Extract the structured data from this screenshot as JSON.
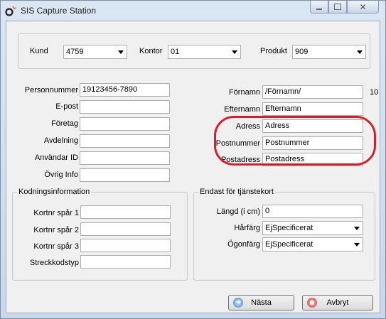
{
  "window": {
    "title": "SIS Capture Station",
    "min_icon": "minimize-icon",
    "max_icon": "maximize-icon",
    "close_icon": "close-icon"
  },
  "top": {
    "kund": {
      "label": "Kund",
      "value": "4759"
    },
    "kontor": {
      "label": "Kontor",
      "value": "01"
    },
    "produkt": {
      "label": "Produkt",
      "value": "909"
    }
  },
  "left": {
    "personnummer": {
      "label": "Personnummer",
      "value": "19123456-7890"
    },
    "epost": {
      "label": "E-post",
      "value": ""
    },
    "foretag": {
      "label": "Företag",
      "value": ""
    },
    "avdelning": {
      "label": "Avdelning",
      "value": ""
    },
    "anvandar_id": {
      "label": "Användar ID",
      "value": ""
    },
    "ovrig_info": {
      "label": "Övrig Info",
      "value": ""
    }
  },
  "right": {
    "fornamn": {
      "label": "Förnamn",
      "value": "/Förnamn/",
      "suffix": "10"
    },
    "efternamn": {
      "label": "Efternamn",
      "value": "Efternamn"
    },
    "adress": {
      "label": "Adress",
      "value": "Adress"
    },
    "postnummer": {
      "label": "Postnummer",
      "value": "Postnummer"
    },
    "postadress": {
      "label": "Postadress",
      "value": "Postadress"
    }
  },
  "kodning": {
    "title": "Kodningsinformation",
    "spar1": {
      "label": "Kortnr spår 1",
      "value": ""
    },
    "spar2": {
      "label": "Kortnr spår 2",
      "value": ""
    },
    "spar3": {
      "label": "Kortnr spår 3",
      "value": ""
    },
    "streckkod": {
      "label": "Streckkodstyp",
      "value": ""
    }
  },
  "tjanstekort": {
    "title": "Endast för tjänstekort",
    "langd": {
      "label": "Längd (i cm)",
      "value": "0"
    },
    "harfarg": {
      "label": "Hårfärg",
      "value": "EjSpecificerat"
    },
    "ogonfarg": {
      "label": "Ögonfärg",
      "value": "EjSpecificerat"
    }
  },
  "buttons": {
    "nasta": "Nästa",
    "avbryt": "Avbryt"
  },
  "colors": {
    "highlight": "#d4202a"
  }
}
